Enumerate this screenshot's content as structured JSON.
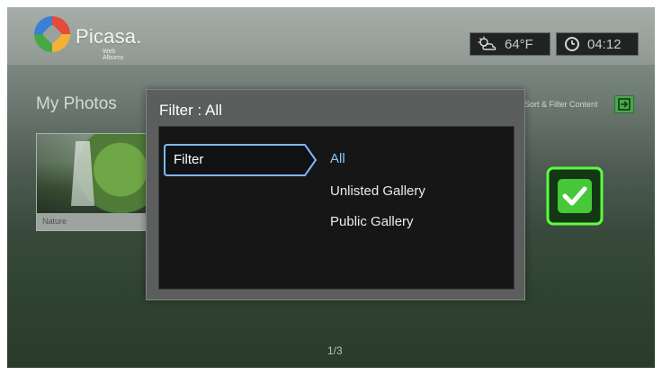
{
  "app": {
    "brand": "Picasa.",
    "brand_sub": "Web Albums"
  },
  "status": {
    "temperature": "64°F",
    "time": "04:12",
    "weather_icon": "partly-cloudy-icon",
    "clock_icon": "clock-icon"
  },
  "page": {
    "title": "My Photos",
    "right_label": "Sort & Filter Content",
    "right_icon": "exit-icon"
  },
  "thumbs": [
    {
      "caption": "Nature"
    }
  ],
  "modal": {
    "title": "Filter : All",
    "tab_label": "Filter",
    "options": [
      {
        "label": "All",
        "selected": true
      },
      {
        "label": "Unlisted Gallery",
        "selected": false
      },
      {
        "label": "Public Gallery",
        "selected": false
      }
    ]
  },
  "confirm": {
    "icon": "checkmark-icon"
  },
  "pager": {
    "text": "1/3"
  },
  "colors": {
    "accent_green": "#51d43f",
    "selected_blue": "#8fc5ff",
    "focus_border": "#7eb7ff"
  }
}
